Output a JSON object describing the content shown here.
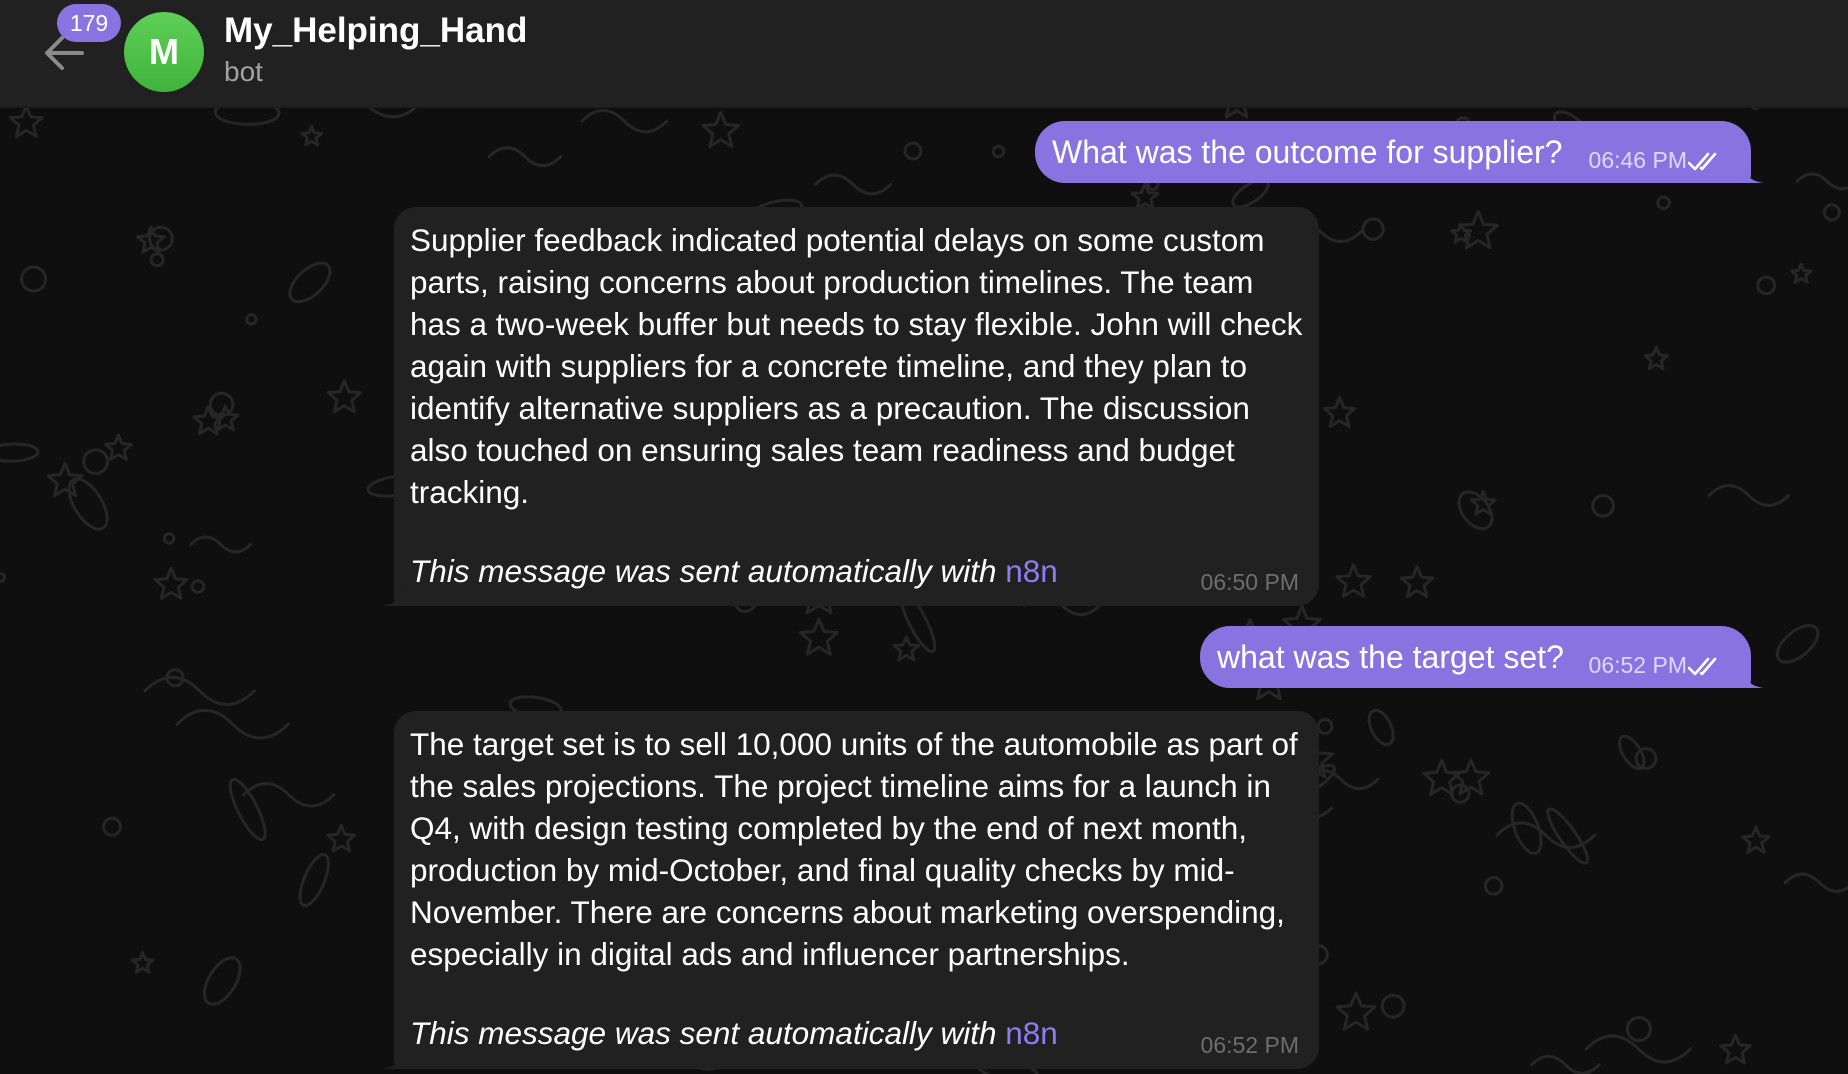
{
  "header": {
    "back_icon": "arrow-left-icon",
    "unread_count": "179",
    "avatar_letter": "M",
    "avatar_color": "#4fc24a",
    "title": "My_Helping_Hand",
    "subtitle": "bot"
  },
  "theme": {
    "accent": "#8774e1",
    "incoming_bubble": "#212121",
    "link": "#8e7cf0",
    "background": "#0f0f0f"
  },
  "messages": [
    {
      "direction": "outgoing",
      "text": "What was the outcome for supplier?",
      "time": "06:46 PM",
      "status_icon": "double-check-icon"
    },
    {
      "direction": "incoming",
      "text": "Supplier feedback indicated potential delays on some custom parts, raising concerns about production timelines. The team has a two-week buffer but needs to stay flexible. John will check again with suppliers for a concrete timeline, and they plan to identify alternative suppliers as a precaution. The discussion also touched on ensuring sales team readiness and budget tracking.",
      "footer_prefix": "This message was sent automatically with ",
      "footer_link": "n8n",
      "time": "06:50 PM"
    },
    {
      "direction": "outgoing",
      "text": "what was the target set?",
      "time": "06:52 PM",
      "status_icon": "double-check-icon"
    },
    {
      "direction": "incoming",
      "text": "The target set is to sell 10,000 units of the automobile as part of the sales projections. The project timeline aims for a launch in Q4, with design testing completed by the end of next month, production by mid-October, and final quality checks by mid-November. There are concerns about marketing overspending, especially in digital ads and influencer partnerships.",
      "footer_prefix": "This message was sent automatically with ",
      "footer_link": "n8n",
      "time": "06:52 PM"
    }
  ]
}
